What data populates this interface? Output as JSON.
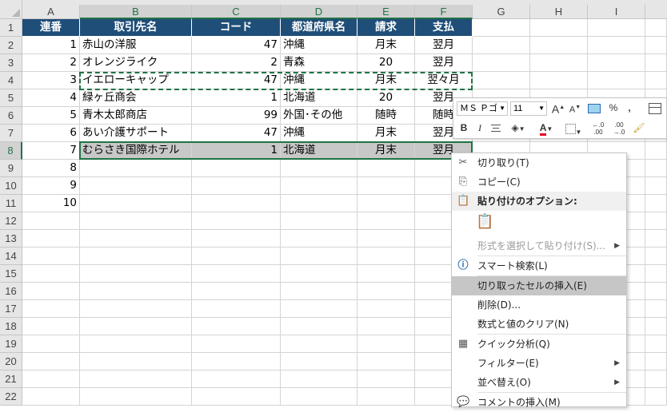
{
  "columns": [
    "A",
    "B",
    "C",
    "D",
    "E",
    "F",
    "G",
    "H",
    "I"
  ],
  "rows": [
    "1",
    "2",
    "3",
    "4",
    "5",
    "6",
    "7",
    "8",
    "9",
    "10",
    "11",
    "12",
    "13",
    "14",
    "15",
    "16",
    "17",
    "18",
    "19",
    "20",
    "21",
    "22"
  ],
  "table": {
    "headers": [
      "連番",
      "取引先名",
      "コード",
      "都道府県名",
      "請求",
      "支払"
    ],
    "data": [
      [
        "1",
        "赤山の洋服",
        "47",
        "沖縄",
        "月末",
        "翌月"
      ],
      [
        "2",
        "オレンジライク",
        "2",
        "青森",
        "20",
        "翌月"
      ],
      [
        "3",
        "イエローキャップ",
        "47",
        "沖縄",
        "月末",
        "翌々月"
      ],
      [
        "4",
        "緑ヶ丘商会",
        "1",
        "北海道",
        "20",
        "翌月"
      ],
      [
        "5",
        "青木太郎商店",
        "99",
        "外国･その他",
        "随時",
        "随時"
      ],
      [
        "6",
        "あい介護サポート",
        "47",
        "沖縄",
        "月末",
        "翌月"
      ],
      [
        "7",
        "むらさき国際ホテル",
        "1",
        "北海道",
        "月末",
        "翌月"
      ],
      [
        "8",
        "",
        "",
        "",
        "",
        ""
      ],
      [
        "9",
        "",
        "",
        "",
        "",
        ""
      ],
      [
        "10",
        "",
        "",
        "",
        "",
        ""
      ]
    ]
  },
  "mini_toolbar": {
    "font_name": "ＭＳ Ｐゴ",
    "font_size": "11",
    "grow_label": "A",
    "shrink_label": "A",
    "percent": "%",
    "comma": ",",
    "bold": "B",
    "italic": "I",
    "font_color_label": "A",
    "inc_decimal": "←.0\n.00",
    "dec_decimal": ".00\n→.0",
    "font_color": "#e8001c"
  },
  "context_menu": {
    "items": [
      {
        "label": "切り取り(T)",
        "icon": "scissors-icon",
        "glyph": "✂"
      },
      {
        "label": "コピー(C)",
        "icon": "copy-icon",
        "glyph": "⎘"
      },
      {
        "label": "貼り付けのオプション:",
        "icon": "paste-icon",
        "glyph": "📋"
      },
      {
        "label": "",
        "icon": "paste-option-icon",
        "glyph": "📋"
      },
      {
        "label": "形式を選択して貼り付け(S)...",
        "icon": "",
        "glyph": ""
      },
      {
        "label": "スマート検索(L)",
        "icon": "smart-lookup-icon",
        "glyph": "ⓘ"
      },
      {
        "label": "切り取ったセルの挿入(E)",
        "icon": "",
        "glyph": ""
      },
      {
        "label": "削除(D)...",
        "icon": "",
        "glyph": ""
      },
      {
        "label": "数式と値のクリア(N)",
        "icon": "",
        "glyph": ""
      },
      {
        "label": "クイック分析(Q)",
        "icon": "quick-analysis-icon",
        "glyph": "▦"
      },
      {
        "label": "フィルター(E)",
        "icon": "",
        "glyph": ""
      },
      {
        "label": "並べ替え(O)",
        "icon": "",
        "glyph": ""
      },
      {
        "label": "コメントの挿入(M)",
        "icon": "comment-icon",
        "glyph": "💬"
      }
    ]
  }
}
